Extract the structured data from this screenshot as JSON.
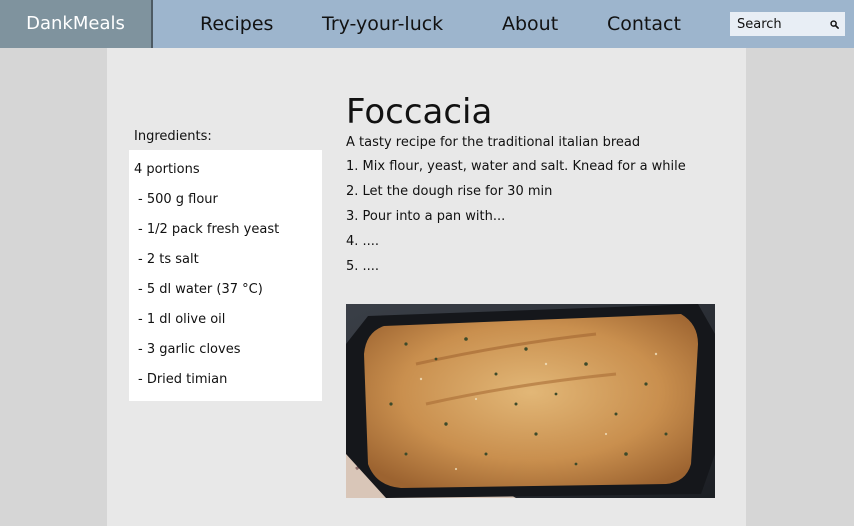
{
  "nav": {
    "brand": "DankMeals",
    "links": [
      "Recipes",
      "Try-your-luck",
      "About",
      "Contact"
    ],
    "search_placeholder": "Search"
  },
  "sidebar": {
    "title": "Ingredients:",
    "portions": "4 portions",
    "items": [
      "- 500 g flour",
      "- 1/2 pack fresh yeast",
      "- 2 ts salt",
      "- 5 dl water (37 °C)",
      "- 1 dl olive oil",
      "- 3 garlic cloves",
      "- Dried timian"
    ]
  },
  "recipe": {
    "title": "Foccacia",
    "description": "A tasty recipe for the traditional italian bread",
    "steps": [
      "1. Mix flour, yeast, water and salt. Knead for a while",
      "2. Let the dough rise for 30 min",
      "3. Pour into a pan with...",
      "4. ....",
      "5. ...."
    ],
    "image_icon": "focaccia-photo"
  },
  "colors": {
    "navbar": "#9db5cd",
    "brand_bg": "#7f939e",
    "page_bg": "#d6d6d6",
    "panel_bg": "#e8e8e8"
  }
}
